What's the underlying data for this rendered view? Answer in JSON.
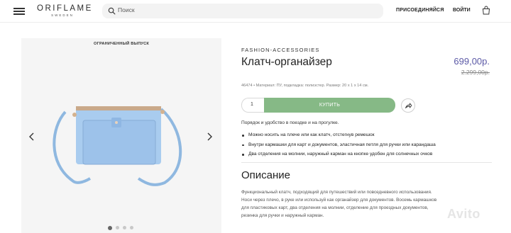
{
  "header": {
    "logo_main": "ORIFLAME",
    "logo_sub": "SWEDEN",
    "search_placeholder": "Поиск",
    "join_label": "ПРИСОЕДИНЯЙСЯ",
    "login_label": "ВОЙТИ"
  },
  "gallery": {
    "badge": "ОГРАНИЧЕННЫЙ ВЫПУСК",
    "dot_count": 4,
    "active_dot": 0,
    "bag_color": "#9ec5ea"
  },
  "product": {
    "brand": "FASHION-ACCESSORIES",
    "title": "Клатч-органайзер",
    "price": "699,00р.",
    "old_price": "2.299,00р.",
    "meta": "46474  •  Материал: ПУ, подкладка: полиэстер. Размер: 20 х 1 х 14 см.",
    "quantity": "1",
    "buy_label": "КУПИТЬ",
    "lead": "Порядок и удобство в поездке и на прогулке.",
    "bullets": [
      "Можно носить на плече или как клатч, отстегнув ремешок",
      "Внутри кармашки для карт и документов, эластичная петля для ручки или карандаша",
      "Два отделения на молнии, наружный карман на кнопке удобен для солнечных очков"
    ]
  },
  "description": {
    "title": "Описание",
    "lines": [
      "Функциональный клатч, подходящий для путешествий или повседневного использования.",
      "Носи через плечо, в руке или используй как органайзер для документов. Восемь кармашков",
      "для пластиковых карт, два отделения на молнии, отделение для проездных документов,",
      "резинка для ручки и наружный карман."
    ]
  },
  "watermark": "Avito",
  "colors": {
    "price": "#5b59a6",
    "buy_button": "#86b986"
  }
}
